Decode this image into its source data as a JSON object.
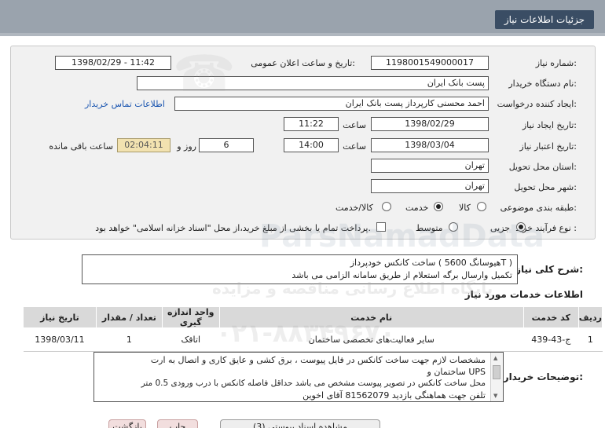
{
  "header": {
    "title": "جزئیات اطلاعات نیاز"
  },
  "form": {
    "need_number": {
      "label": "شماره نیاز:",
      "value": "1198001549000017"
    },
    "announce": {
      "label": "تاریخ و ساعت اعلان عمومی:",
      "value": "1398/02/29 - 11:42"
    },
    "buyer": {
      "label": "نام دستگاه خریدار:",
      "value": "پست بانک ایران"
    },
    "requester": {
      "label": "ایجاد کننده درخواست:",
      "value": "احمد  محسنی کارپرداز پست بانک ایران",
      "contact_link": "اطلاعات تماس خریدار"
    },
    "created": {
      "label": "تاریخ ایجاد نیاز:",
      "date": "1398/02/29",
      "time_label": "ساعت",
      "time": "11:22"
    },
    "validity": {
      "label": "تاریخ اعتبار نیاز:",
      "date": "1398/03/04",
      "time_label": "ساعت",
      "time": "14:00",
      "days": "6",
      "days_label": "روز و",
      "remaining": "02:04:11",
      "remaining_label": "ساعت باقی مانده"
    },
    "province": {
      "label": "استان محل تحویل:",
      "value": "تهران"
    },
    "city": {
      "label": "شهر محل تحویل:",
      "value": "تهران"
    },
    "category": {
      "label": "طبقه بندی موضوعی:",
      "options": [
        "کالا",
        "خدمت",
        "کالا/خدمت"
      ],
      "selected": "خدمت"
    },
    "process": {
      "label": "نوع فرآیند خرید :",
      "options": [
        "جزیی",
        "متوسط"
      ],
      "selected": "جزیی",
      "payment_note": "پرداخت تمام یا بخشی از مبلغ خرید،از محل \"اسناد خزانه اسلامی\" خواهد بود."
    }
  },
  "summary": {
    "label": "شرح کلی نیاز:",
    "line1": "ساخت کانکس خودپرداز ( هیوسانگ 5600T )",
    "line2": "تکمیل وارسال برگه استعلام از طریق سامانه الزامی می باشد"
  },
  "services": {
    "title": "اطلاعات خدمات مورد نیاز",
    "columns": [
      "ردیف",
      "کد خدمت",
      "نام خدمت",
      "واحد اندازه گیری",
      "تعداد / مقدار",
      "تاریخ نیاز"
    ],
    "rows": [
      {
        "row": "1",
        "code": "ج-43-439",
        "name": "سایر فعالیت‌های تخصصی ساختمان",
        "unit": "اتاقک",
        "qty": "1",
        "date": "1398/03/11"
      }
    ]
  },
  "notes": {
    "label": "توضیحات خریدار:",
    "lines": [
      "مشخصات لازم جهت ساخت کانکس در فایل پیوست ، برق کشی و عایق کاری و اتصال به ارت",
      "ساختمان و UPS",
      "محل ساخت کانکس در تصویر پیوست مشخص می باشد حداقل فاصله کانکس با درب ورودی 0.5 متر",
      "تلفن جهت هماهنگی بازدید 81562079 آقای اخوین"
    ]
  },
  "footer": {
    "buttons": [
      "بازگشت",
      "چاپ",
      "مشاهده اسناد پیوستی (3)"
    ]
  },
  "watermark": {
    "brand": "ParsNamadData",
    "line": "پایگاه اطلاع رسانی مناقصه و مزایده",
    "phone": "۰۲۱-۸۸۳۴۹۶۷۰"
  },
  "colors": {
    "title_bg": "#3a4d64",
    "panel_bg": "#f1f1f1",
    "link": "#1a55b0",
    "timer_bg": "#f2e2b0"
  }
}
